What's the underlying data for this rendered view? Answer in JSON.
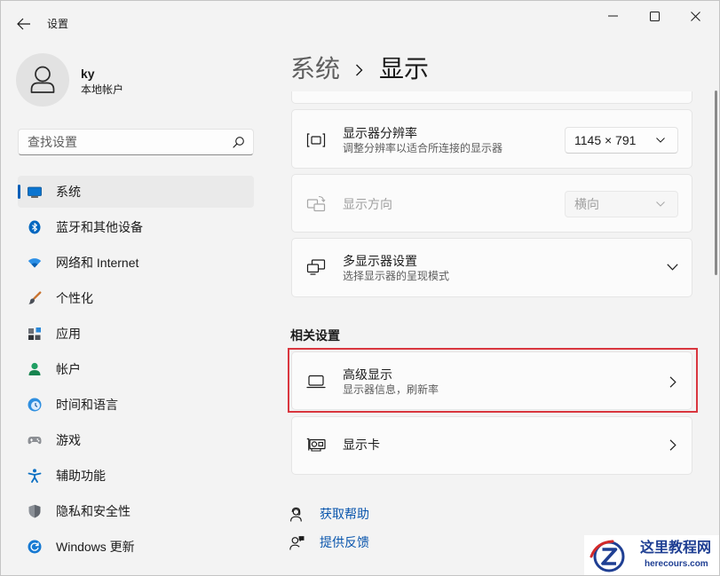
{
  "window": {
    "title": "设置"
  },
  "user": {
    "name": "ky",
    "account_type": "本地帐户",
    "icon": "user-icon"
  },
  "search": {
    "placeholder": "查找设置",
    "icon": "search-icon"
  },
  "sidebar": {
    "items": [
      {
        "label": "系统",
        "icon": "monitor-icon",
        "selected": true
      },
      {
        "label": "蓝牙和其他设备",
        "icon": "bluetooth-icon"
      },
      {
        "label": "网络和 Internet",
        "icon": "wifi-icon"
      },
      {
        "label": "个性化",
        "icon": "brush-icon"
      },
      {
        "label": "应用",
        "icon": "apps-icon"
      },
      {
        "label": "帐户",
        "icon": "account-icon"
      },
      {
        "label": "时间和语言",
        "icon": "time-language-icon"
      },
      {
        "label": "游戏",
        "icon": "gamepad-icon"
      },
      {
        "label": "辅助功能",
        "icon": "accessibility-icon"
      },
      {
        "label": "隐私和安全性",
        "icon": "shield-icon"
      },
      {
        "label": "Windows 更新",
        "icon": "update-icon"
      }
    ]
  },
  "breadcrumb": {
    "parent": "系统",
    "current": "显示",
    "separator_icon": "chevron-right-icon"
  },
  "display": {
    "resolution": {
      "title": "显示器分辨率",
      "subtitle": "调整分辨率以适合所连接的显示器",
      "value": "1145 × 791",
      "icon": "resolution-icon"
    },
    "orientation": {
      "title": "显示方向",
      "value": "横向",
      "disabled": true,
      "icon": "orientation-icon"
    },
    "multiple_displays": {
      "title": "多显示器设置",
      "subtitle": "选择显示器的呈现模式",
      "icon": "multi-display-icon",
      "expanded": false
    }
  },
  "related": {
    "heading": "相关设置",
    "advanced_display": {
      "title": "高级显示",
      "subtitle": "显示器信息，刷新率",
      "icon": "laptop-display-icon",
      "highlighted": true
    },
    "graphics": {
      "title": "显示卡",
      "icon": "graphics-card-icon"
    }
  },
  "links": {
    "help": {
      "label": "获取帮助",
      "icon": "help-icon"
    },
    "feedback": {
      "label": "提供反馈",
      "icon": "feedback-icon"
    }
  },
  "watermark": {
    "name": "这里教程网",
    "site": "herecours.com"
  },
  "colors": {
    "accent": "#005fb8",
    "highlight": "#d9363e",
    "link": "#0a56ad",
    "window_bg": "#f3f3f3",
    "card_bg": "#fbfbfb",
    "card_border": "#e5e5e5"
  }
}
